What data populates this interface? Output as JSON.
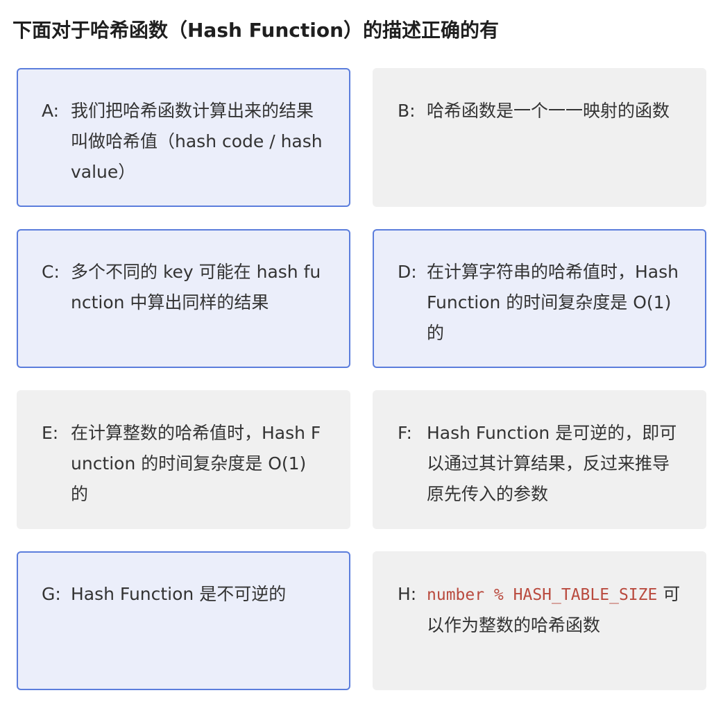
{
  "question": {
    "title": "下面对于哈希函数（Hash Function）的描述正确的有"
  },
  "options": [
    {
      "letter": "A:",
      "text": "我们把哈希函数计算出来的结果叫做哈希值（hash code / hash value）",
      "selected": true
    },
    {
      "letter": "B:",
      "text": "哈希函数是一个一一映射的函数",
      "selected": false
    },
    {
      "letter": "C:",
      "text": "多个不同的 key 可能在 hash function 中算出同样的结果",
      "selected": true
    },
    {
      "letter": "D:",
      "text": "在计算字符串的哈希值时，Hash Function 的时间复杂度是 O(1) 的",
      "selected": true
    },
    {
      "letter": "E:",
      "text": "在计算整数的哈希值时，Hash Function 的时间复杂度是 O(1) 的",
      "selected": false
    },
    {
      "letter": "F:",
      "text": "Hash Function 是可逆的，即可以通过其计算结果，反过来推导原先传入的参数",
      "selected": false
    },
    {
      "letter": "G:",
      "text": "Hash Function 是不可逆的",
      "selected": true
    },
    {
      "letter": "H:",
      "code": "number % HASH_TABLE_SIZE",
      "text": " 可以作为整数的哈希函数",
      "selected": false
    }
  ],
  "colors": {
    "selected_border": "#5b7ddc",
    "selected_background": "#ebeefa",
    "unselected_background": "#f0f0f0",
    "code_text": "#b94a3e"
  }
}
